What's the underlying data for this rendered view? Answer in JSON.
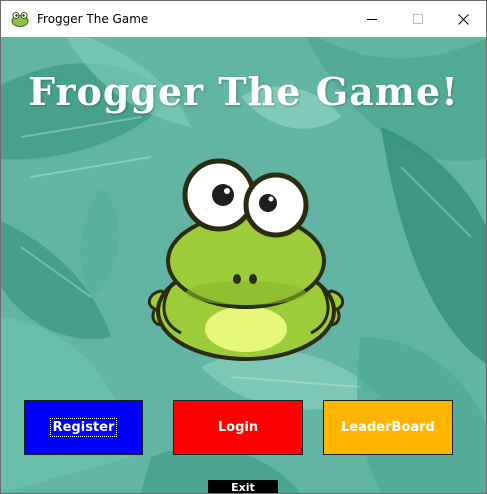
{
  "window": {
    "title": "Frogger The Game"
  },
  "main": {
    "game_title": "Frogger The Game!"
  },
  "buttons": {
    "register": "Register",
    "login": "Login",
    "leaderboard": "LeaderBoard",
    "exit": "Exit"
  },
  "colors": {
    "register": "#0000ff",
    "login": "#ff0000",
    "leaderboard": "#ffb400",
    "exit": "#000000",
    "background": "#5fb3a3"
  },
  "icons": {
    "app": "frog-icon",
    "minimize": "minimize-icon",
    "maximize": "maximize-icon",
    "close": "close-icon"
  }
}
